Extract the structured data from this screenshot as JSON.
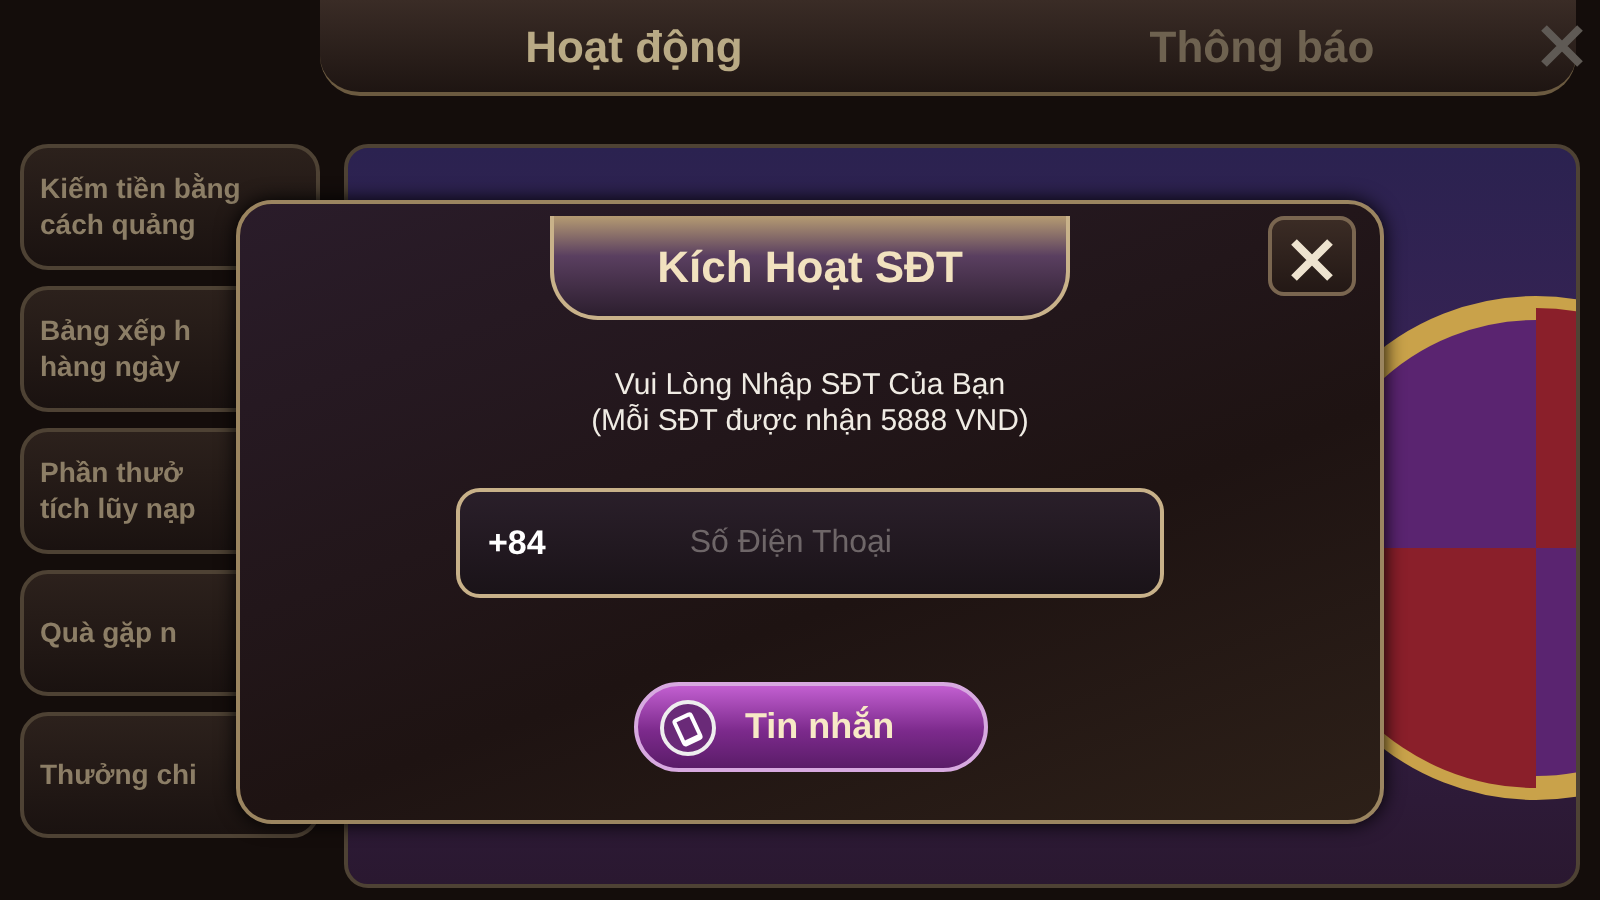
{
  "header": {
    "tabs": [
      {
        "label": "Hoạt động",
        "selected": true
      },
      {
        "label": "Thông báo",
        "selected": false
      }
    ]
  },
  "sidebar": {
    "items": [
      {
        "label": "Kiếm tiền bằng\ncách quảng"
      },
      {
        "label": "Bảng xếp h\nhàng ngày"
      },
      {
        "label": "Phần thưở\ntích lũy nạp"
      },
      {
        "label": "Quà gặp n"
      },
      {
        "label": "Thưởng chi"
      }
    ]
  },
  "dialog": {
    "title": "Kích Hoạt SĐT",
    "message_lines": [
      "Vui Lòng Nhập SĐT Của Bạn",
      "(Mỗi SĐT được nhận 5888 VND)"
    ],
    "phone_field": {
      "prefix": "+84",
      "placeholder": "Số Điện Thoại"
    },
    "button": {
      "label": "Tin nhắn"
    }
  }
}
